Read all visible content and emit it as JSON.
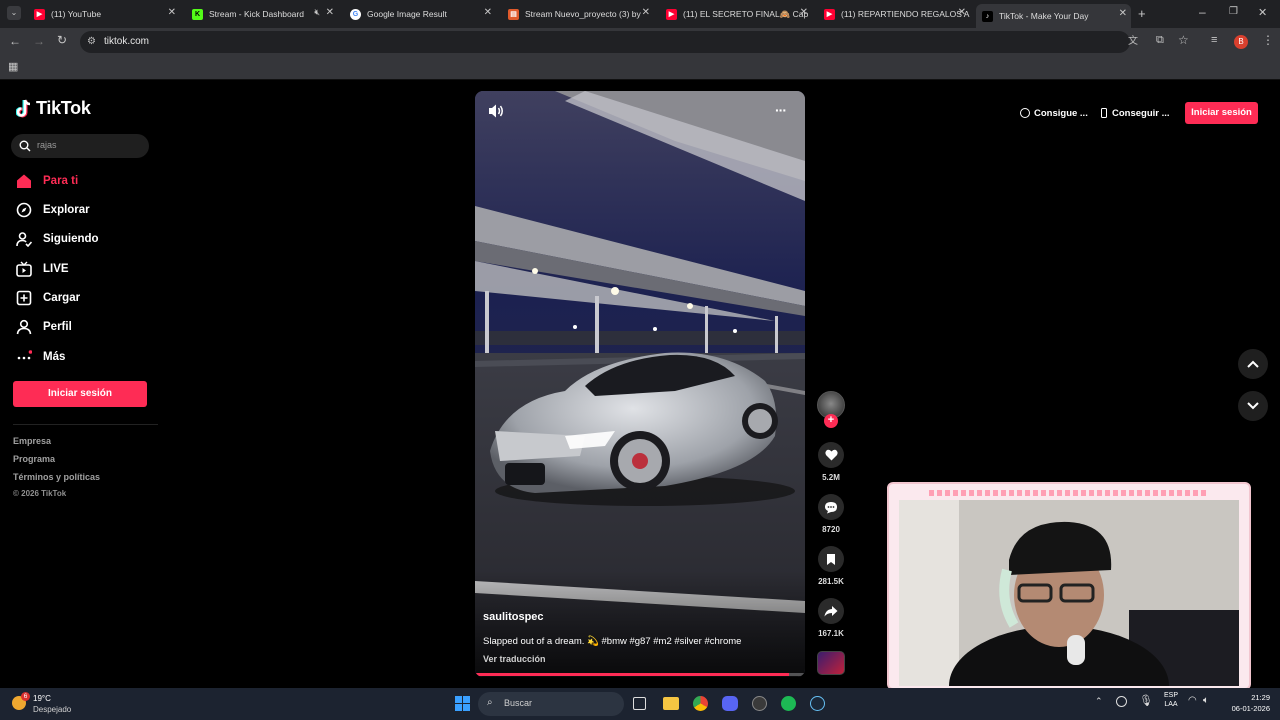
{
  "browser": {
    "tabs": [
      {
        "title": "(11) YouTube",
        "icon_color": "#ff0033"
      },
      {
        "title": "Stream - Kick Dashboard",
        "icon_color": "#53fc18"
      },
      {
        "title": "Google Image Result",
        "icon_color": "#4285f4"
      },
      {
        "title": "Stream Nuevo_proyecto (3) by",
        "icon_color": "#e05a2b"
      },
      {
        "title": "(11) EL SECRETO FINAL🙈 Cap",
        "icon_color": "#ff0033"
      },
      {
        "title": "(11) REPARTIENDO REGALOS A",
        "icon_color": "#ff0033"
      },
      {
        "title": "TikTok - Make Your Day",
        "icon_color": "#ffffff"
      }
    ],
    "url": "tiktok.com",
    "profile_initial": "B"
  },
  "sidebar": {
    "logo": "TikTok",
    "search_value": "rajas",
    "nav": [
      {
        "label": "Para ti",
        "icon": "home-icon"
      },
      {
        "label": "Explorar",
        "icon": "compass-icon"
      },
      {
        "label": "Siguiendo",
        "icon": "following-icon"
      },
      {
        "label": "LIVE",
        "icon": "live-icon"
      },
      {
        "label": "Cargar",
        "icon": "upload-icon"
      },
      {
        "label": "Perfil",
        "icon": "profile-icon"
      },
      {
        "label": "Más",
        "icon": "more-icon"
      }
    ],
    "login_button": "Iniciar sesión",
    "footer": [
      "Empresa",
      "Programa",
      "Términos y políticas"
    ],
    "copyright": "© 2026 TikTok"
  },
  "header_right": {
    "get_coins": "Consigue ...",
    "get_app": "Conseguir ...",
    "login": "Iniciar sesión"
  },
  "video": {
    "username": "saulitospec",
    "caption": "Slapped out of a dream. 💫 #bmw #g87 #m2 #silver #chrome",
    "translate": "Ver traducción",
    "likes": "5.2M",
    "comments": "8720",
    "saves": "281.5K",
    "shares": "167.1K"
  },
  "taskbar": {
    "weather_temp": "19°C",
    "weather_desc": "Despejado",
    "weather_badge": "6",
    "search_placeholder": "Buscar",
    "lang": "ESP",
    "lang2": "LAA",
    "time": "21:29",
    "date": "06-01-2026"
  },
  "colors": {
    "accent": "#fe2c55",
    "bg": "#000000"
  }
}
